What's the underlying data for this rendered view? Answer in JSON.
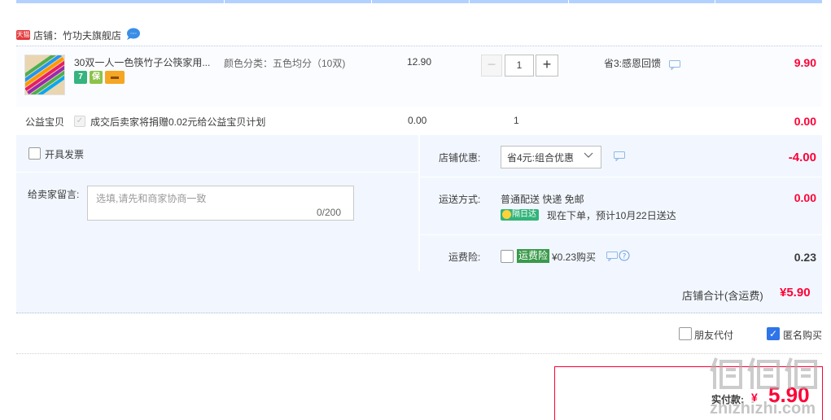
{
  "shop": {
    "tmall_badge": "天猫",
    "label": "店铺：竹功夫旗舰店",
    "ww_icon": "wangwang-chat-icon"
  },
  "item": {
    "title": "30双一人一色筷竹子公筷家用...",
    "sku": "颜色分类：五色均分（10双)",
    "price": "12.90",
    "quantity": "1",
    "minus_label": "−",
    "plus_label": "+",
    "promotion": "省3:感恩回馈",
    "subtotal": "9.90",
    "badges": [
      {
        "text": "7",
        "color": "#36b37e",
        "icon": "seven-day-return-icon"
      },
      {
        "text": "保",
        "color": "#8bc34a",
        "icon": "guarantee-icon"
      },
      {
        "text": "▬",
        "color": "#f5a623",
        "icon": "credit-card-icon"
      }
    ]
  },
  "charity": {
    "name": "公益宝贝",
    "text": "成交后卖家将捐赠0.02元给公益宝贝计划",
    "price": "0.00",
    "quantity": "1",
    "subtotal": "0.00"
  },
  "options": {
    "invoice_label": "开具发票",
    "message_label": "给卖家留言:",
    "message_placeholder": "选填,请先和商家协商一致",
    "message_count": "0/200",
    "shop_discount_label": "店铺优惠:",
    "shop_discount_value": "省4元:组合优惠",
    "shop_discount_amount": "-4.00",
    "shipping_label": "运送方式:",
    "shipping_value": "普通配送 快递 免邮",
    "shipping_badge": "隔日达",
    "shipping_eta": "现在下单，预计10月22日送达",
    "shipping_amount": "0.00",
    "insurance_label": "运费险:",
    "insurance_tag": "运费险",
    "insurance_price": "¥0.23购买",
    "insurance_amount": "0.23"
  },
  "total": {
    "label": "店铺合计(含运费)",
    "value": "¥5.90"
  },
  "footer": {
    "friend_pay_label": "朋友代付",
    "anonymous_label": "匿名购买",
    "anonymous_checked": true,
    "pay_label": "实付款:",
    "pay_currency": "¥",
    "pay_value": "5.90"
  },
  "watermark": {
    "text": "zhizhizhi.com"
  },
  "colors": {
    "accent_red": "#ff0036",
    "panel_blue": "#f2f7ff",
    "check_blue": "#2f74e8",
    "top_line": "#b2d1ff"
  }
}
